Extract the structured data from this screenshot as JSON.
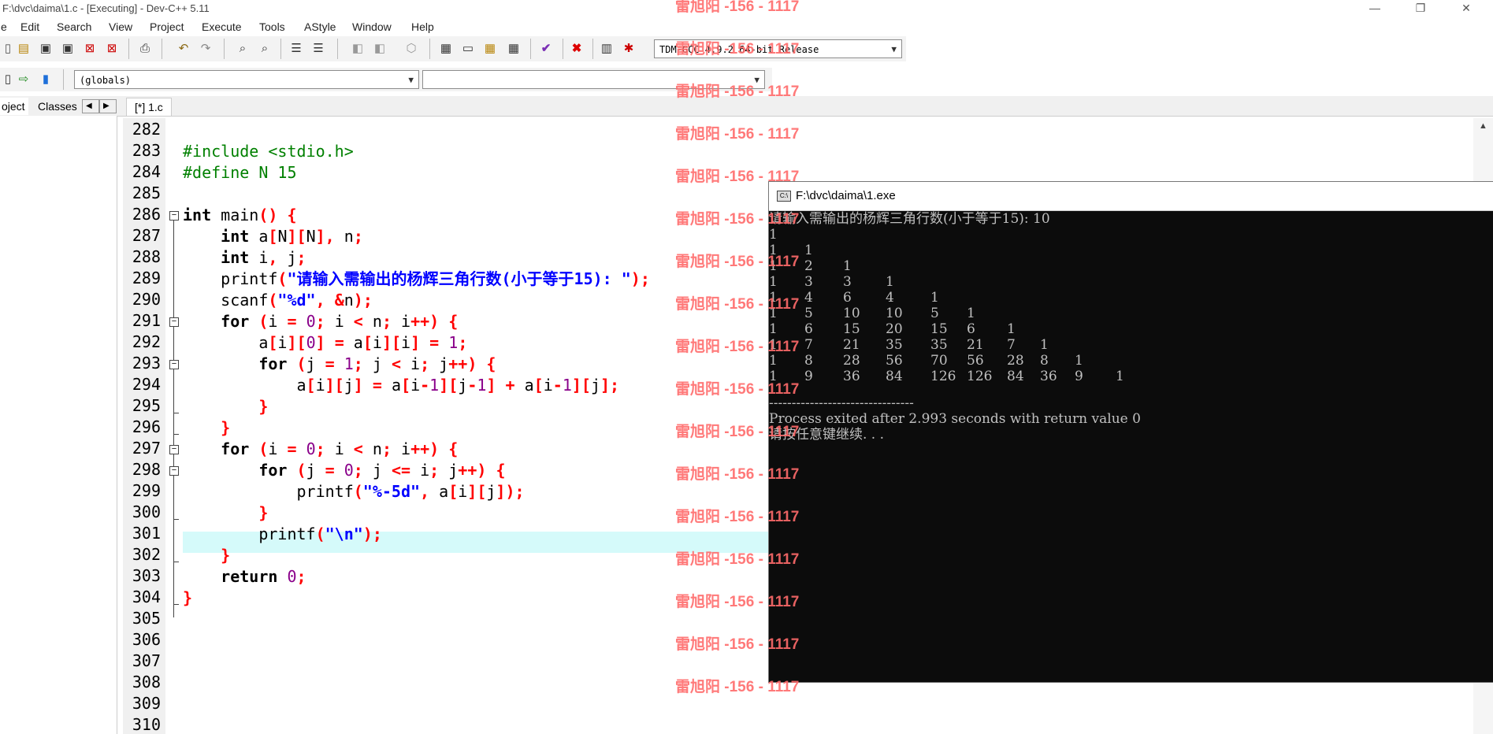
{
  "window": {
    "title": "F:\\dvc\\daima\\1.c - [Executing] - Dev-C++ 5.11",
    "minimize_glyph": "—",
    "restore_glyph": "❐",
    "close_glyph": "✕"
  },
  "menu": [
    "e",
    "Edit",
    "Search",
    "View",
    "Project",
    "Execute",
    "Tools",
    "AStyle",
    "Window",
    "Help"
  ],
  "toolbar": {
    "compiler": "TDM-GCC 4.9.2 64-bit Release",
    "scope": "(globals)",
    "symbol": ""
  },
  "tabs": {
    "project": "oject",
    "classes": "Classes",
    "file": "[*] 1.c"
  },
  "editor": {
    "line_numbers": [
      "282",
      "283",
      "284",
      "285",
      "286",
      "287",
      "288",
      "289",
      "290",
      "291",
      "292",
      "293",
      "294",
      "295",
      "296",
      "297",
      "298",
      "299",
      "300",
      "301",
      "302",
      "303",
      "304",
      "305",
      "306",
      "307",
      "308",
      "309",
      "310"
    ],
    "lines": [
      [],
      [
        [
          "pp",
          "#include <stdio.h>"
        ]
      ],
      [
        [
          "pp",
          "#define N 15"
        ]
      ],
      [],
      [
        [
          "kw",
          "int"
        ],
        [
          "id",
          " main"
        ],
        [
          "sy",
          "()"
        ],
        [
          "id",
          " "
        ],
        [
          "sy",
          "{"
        ]
      ],
      [
        [
          "id",
          "    "
        ],
        [
          "kw",
          "int"
        ],
        [
          "id",
          " a"
        ],
        [
          "sy",
          "["
        ],
        [
          "id",
          "N"
        ],
        [
          "sy",
          "]["
        ],
        [
          "id",
          "N"
        ],
        [
          "sy",
          "],"
        ],
        [
          "id",
          " n"
        ],
        [
          "sy",
          ";"
        ]
      ],
      [
        [
          "id",
          "    "
        ],
        [
          "kw",
          "int"
        ],
        [
          "id",
          " i"
        ],
        [
          "sy",
          ","
        ],
        [
          "id",
          " j"
        ],
        [
          "sy",
          ";"
        ]
      ],
      [
        [
          "id",
          "    printf"
        ],
        [
          "sy",
          "("
        ],
        [
          "st",
          "\"请输入需输出的杨辉三角行数(小于等于15): \""
        ],
        [
          "sy",
          ");"
        ]
      ],
      [
        [
          "id",
          "    scanf"
        ],
        [
          "sy",
          "("
        ],
        [
          "st",
          "\"%d\""
        ],
        [
          "sy",
          ","
        ],
        [
          "id",
          " "
        ],
        [
          "sy",
          "&"
        ],
        [
          "id",
          "n"
        ],
        [
          "sy",
          ");"
        ]
      ],
      [
        [
          "id",
          "    "
        ],
        [
          "kw",
          "for"
        ],
        [
          "id",
          " "
        ],
        [
          "sy",
          "("
        ],
        [
          "id",
          "i "
        ],
        [
          "sy",
          "="
        ],
        [
          "id",
          " "
        ],
        [
          "nm",
          "0"
        ],
        [
          "sy",
          ";"
        ],
        [
          "id",
          " i "
        ],
        [
          "sy",
          "<"
        ],
        [
          "id",
          " n"
        ],
        [
          "sy",
          ";"
        ],
        [
          "id",
          " i"
        ],
        [
          "sy",
          "++)"
        ],
        [
          "id",
          " "
        ],
        [
          "sy",
          "{"
        ]
      ],
      [
        [
          "id",
          "        a"
        ],
        [
          "sy",
          "["
        ],
        [
          "id",
          "i"
        ],
        [
          "sy",
          "]["
        ],
        [
          "nm",
          "0"
        ],
        [
          "sy",
          "]"
        ],
        [
          "id",
          " "
        ],
        [
          "sy",
          "="
        ],
        [
          "id",
          " a"
        ],
        [
          "sy",
          "["
        ],
        [
          "id",
          "i"
        ],
        [
          "sy",
          "]["
        ],
        [
          "id",
          "i"
        ],
        [
          "sy",
          "]"
        ],
        [
          "id",
          " "
        ],
        [
          "sy",
          "="
        ],
        [
          "id",
          " "
        ],
        [
          "nm",
          "1"
        ],
        [
          "sy",
          ";"
        ]
      ],
      [
        [
          "id",
          "        "
        ],
        [
          "kw",
          "for"
        ],
        [
          "id",
          " "
        ],
        [
          "sy",
          "("
        ],
        [
          "id",
          "j "
        ],
        [
          "sy",
          "="
        ],
        [
          "id",
          " "
        ],
        [
          "nm",
          "1"
        ],
        [
          "sy",
          ";"
        ],
        [
          "id",
          " j "
        ],
        [
          "sy",
          "<"
        ],
        [
          "id",
          " i"
        ],
        [
          "sy",
          ";"
        ],
        [
          "id",
          " j"
        ],
        [
          "sy",
          "++)"
        ],
        [
          "id",
          " "
        ],
        [
          "sy",
          "{"
        ]
      ],
      [
        [
          "id",
          "            a"
        ],
        [
          "sy",
          "["
        ],
        [
          "id",
          "i"
        ],
        [
          "sy",
          "]["
        ],
        [
          "id",
          "j"
        ],
        [
          "sy",
          "]"
        ],
        [
          "id",
          " "
        ],
        [
          "sy",
          "="
        ],
        [
          "id",
          " a"
        ],
        [
          "sy",
          "["
        ],
        [
          "id",
          "i"
        ],
        [
          "sy",
          "-"
        ],
        [
          "nm",
          "1"
        ],
        [
          "sy",
          "]["
        ],
        [
          "id",
          "j"
        ],
        [
          "sy",
          "-"
        ],
        [
          "nm",
          "1"
        ],
        [
          "sy",
          "]"
        ],
        [
          "id",
          " "
        ],
        [
          "sy",
          "+"
        ],
        [
          "id",
          " a"
        ],
        [
          "sy",
          "["
        ],
        [
          "id",
          "i"
        ],
        [
          "sy",
          "-"
        ],
        [
          "nm",
          "1"
        ],
        [
          "sy",
          "]["
        ],
        [
          "id",
          "j"
        ],
        [
          "sy",
          "];"
        ]
      ],
      [
        [
          "id",
          "        "
        ],
        [
          "sy",
          "}"
        ]
      ],
      [
        [
          "id",
          "    "
        ],
        [
          "sy",
          "}"
        ]
      ],
      [
        [
          "id",
          "    "
        ],
        [
          "kw",
          "for"
        ],
        [
          "id",
          " "
        ],
        [
          "sy",
          "("
        ],
        [
          "id",
          "i "
        ],
        [
          "sy",
          "="
        ],
        [
          "id",
          " "
        ],
        [
          "nm",
          "0"
        ],
        [
          "sy",
          ";"
        ],
        [
          "id",
          " i "
        ],
        [
          "sy",
          "<"
        ],
        [
          "id",
          " n"
        ],
        [
          "sy",
          ";"
        ],
        [
          "id",
          " i"
        ],
        [
          "sy",
          "++)"
        ],
        [
          "id",
          " "
        ],
        [
          "sy",
          "{"
        ]
      ],
      [
        [
          "id",
          "        "
        ],
        [
          "kw",
          "for"
        ],
        [
          "id",
          " "
        ],
        [
          "sy",
          "("
        ],
        [
          "id",
          "j "
        ],
        [
          "sy",
          "="
        ],
        [
          "id",
          " "
        ],
        [
          "nm",
          "0"
        ],
        [
          "sy",
          ";"
        ],
        [
          "id",
          " j "
        ],
        [
          "sy",
          "<="
        ],
        [
          "id",
          " i"
        ],
        [
          "sy",
          ";"
        ],
        [
          "id",
          " j"
        ],
        [
          "sy",
          "++)"
        ],
        [
          "id",
          " "
        ],
        [
          "sy",
          "{"
        ]
      ],
      [
        [
          "id",
          "            printf"
        ],
        [
          "sy",
          "("
        ],
        [
          "st",
          "\"%-5d\""
        ],
        [
          "sy",
          ","
        ],
        [
          "id",
          " a"
        ],
        [
          "sy",
          "["
        ],
        [
          "id",
          "i"
        ],
        [
          "sy",
          "]["
        ],
        [
          "id",
          "j"
        ],
        [
          "sy",
          "]);"
        ]
      ],
      [
        [
          "id",
          "        "
        ],
        [
          "sy",
          "}"
        ]
      ],
      [
        [
          "id",
          "        printf"
        ],
        [
          "sy",
          "("
        ],
        [
          "st",
          "\"\\n\""
        ],
        [
          "sy",
          ");"
        ]
      ],
      [
        [
          "id",
          "    "
        ],
        [
          "sy",
          "}"
        ]
      ],
      [
        [
          "id",
          "    "
        ],
        [
          "kw",
          "return"
        ],
        [
          "id",
          " "
        ],
        [
          "nm",
          "0"
        ],
        [
          "sy",
          ";"
        ]
      ],
      [
        [
          "sy",
          "}"
        ]
      ],
      [],
      [],
      [],
      [],
      [],
      []
    ]
  },
  "console": {
    "title": "F:\\dvc\\daima\\1.exe",
    "prompt": "请输入需输出的杨辉三角行数(小于等于15): 10",
    "rows": [
      [
        "1"
      ],
      [
        "1",
        "1"
      ],
      [
        "1",
        "2",
        "1"
      ],
      [
        "1",
        "3",
        "3",
        "1"
      ],
      [
        "1",
        "4",
        "6",
        "4",
        "1"
      ],
      [
        "1",
        "5",
        "10",
        "10",
        "5",
        "1"
      ],
      [
        "1",
        "6",
        "15",
        "20",
        "15",
        "6",
        "1"
      ],
      [
        "1",
        "7",
        "21",
        "35",
        "35",
        "21",
        "7",
        "1"
      ],
      [
        "1",
        "8",
        "28",
        "56",
        "70",
        "56",
        "28",
        "8",
        "1"
      ],
      [
        "1",
        "9",
        "36",
        "84",
        "126",
        "126",
        "84",
        "36",
        "9",
        "1"
      ]
    ],
    "separator": "--------------------------------",
    "exit_msg": "Process exited after 2.993 seconds with return value 0",
    "continue_msg": "请按任意键继续. . ."
  },
  "watermark": "雷旭阳 -156 - 1117"
}
